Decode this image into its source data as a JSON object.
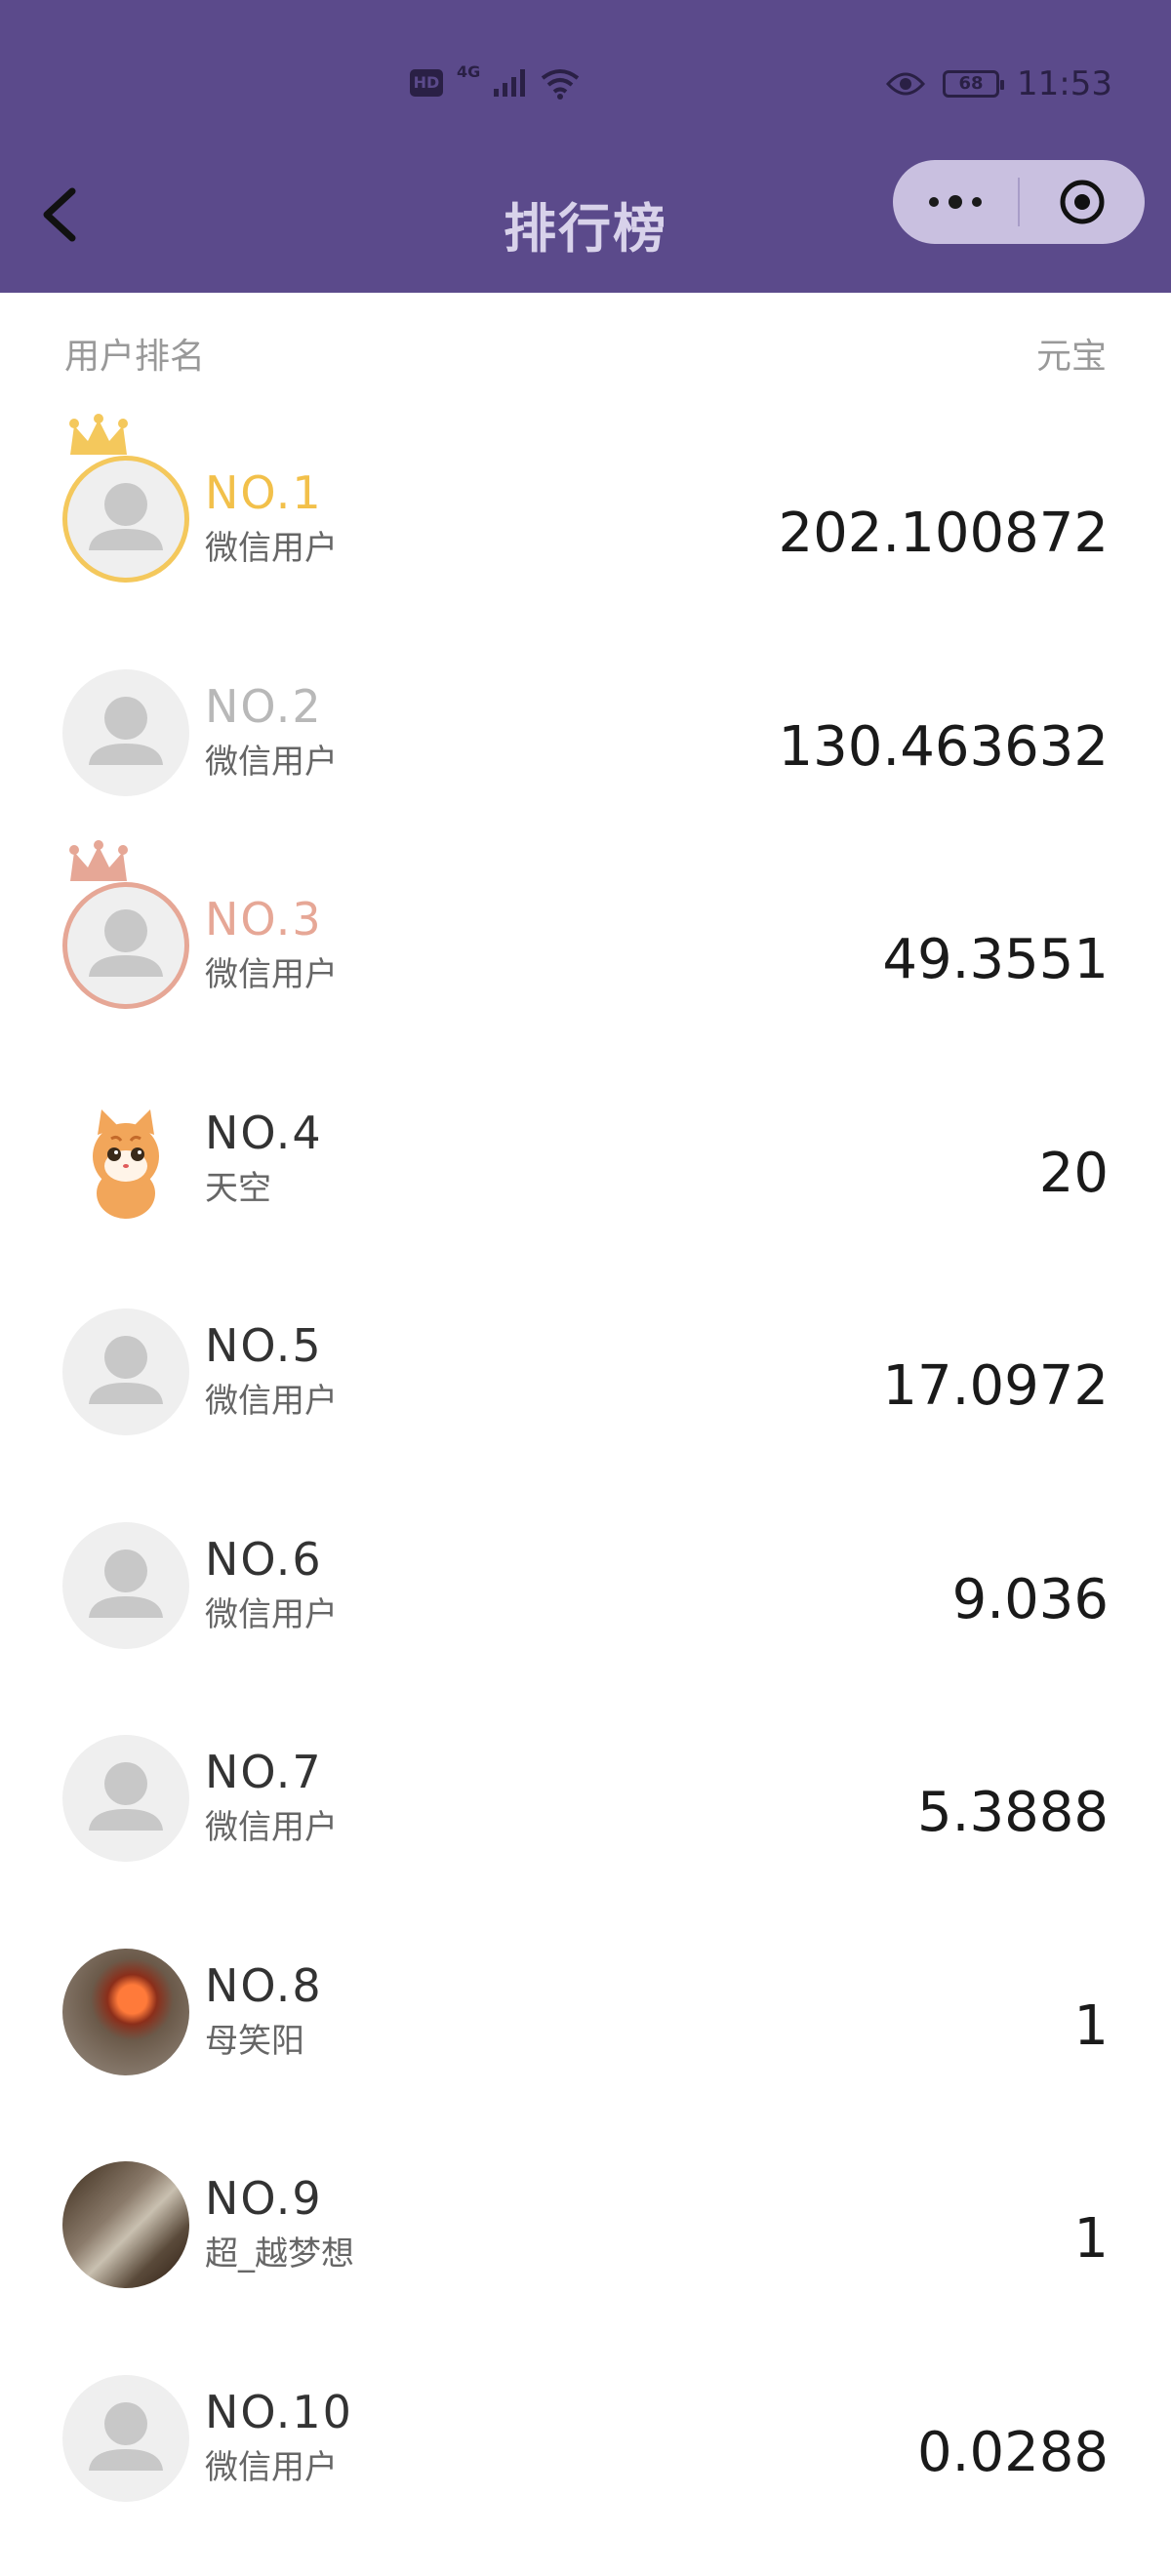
{
  "status_bar": {
    "hd_label": "HD",
    "network_label": "4G",
    "battery_level": "68",
    "time": "11:53"
  },
  "nav": {
    "title": "排行榜"
  },
  "list_header": {
    "left": "用户排名",
    "right": "元宝"
  },
  "rankings": [
    {
      "rank": "NO.1",
      "name": "微信用户",
      "value": "202.100872"
    },
    {
      "rank": "NO.2",
      "name": "微信用户",
      "value": "130.463632"
    },
    {
      "rank": "NO.3",
      "name": "微信用户",
      "value": "49.3551"
    },
    {
      "rank": "NO.4",
      "name": "天空",
      "value": "20"
    },
    {
      "rank": "NO.5",
      "name": "微信用户",
      "value": "17.0972"
    },
    {
      "rank": "NO.6",
      "name": "微信用户",
      "value": "9.036"
    },
    {
      "rank": "NO.7",
      "name": "微信用户",
      "value": "5.3888"
    },
    {
      "rank": "NO.8",
      "name": "母笑阳",
      "value": "1"
    },
    {
      "rank": "NO.9",
      "name": "超_越梦想",
      "value": "1"
    },
    {
      "rank": "NO.10",
      "name": "微信用户",
      "value": "0.0288"
    }
  ],
  "colors": {
    "header_bg": "#5b4a8b",
    "gold": "#f2c04a",
    "silver": "#b8b8b8",
    "bronze": "#e6a796"
  }
}
